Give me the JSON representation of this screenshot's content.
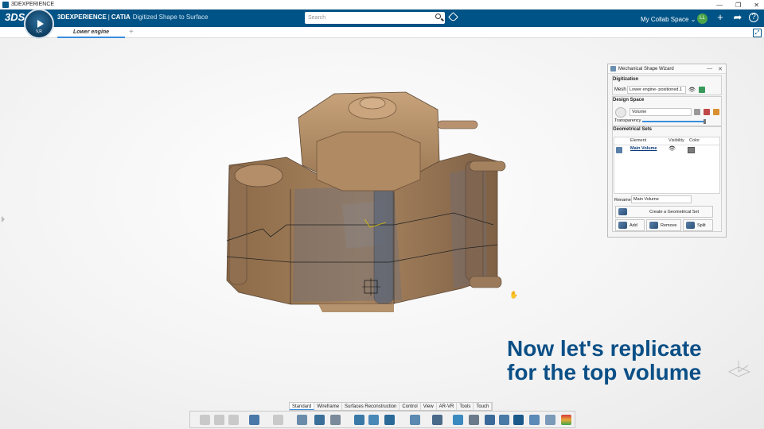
{
  "os": {
    "title": "3DEXPERIENCE",
    "controls": [
      "—",
      "❐",
      "✕"
    ]
  },
  "app": {
    "logo_text": "3DS",
    "brand_strong": "3DEXPERIENCE",
    "brand_app": "CATIA",
    "brand_module": "Digitized Shape to Surface",
    "search_placeholder": "Search",
    "collab_space": "My Collab Space",
    "avatar_initials": "LL",
    "compass_label": "V,R"
  },
  "tabs": [
    {
      "label": "Lower engine"
    }
  ],
  "wizard": {
    "title": "Mechanical Shape Wizard",
    "digitization": {
      "header": "Digitization",
      "mesh_label": "Mesh",
      "mesh_value": "Lower engine- positioned.1"
    },
    "design_space": {
      "header": "Design Space",
      "value": "Volume",
      "transparency_label": "Transparency",
      "transparency_value": 0.95
    },
    "geometrical_sets": {
      "header": "Geometrical Sets",
      "columns": [
        "Element",
        "Visibility",
        "Color"
      ],
      "rows": [
        {
          "element": "Main Volume",
          "visible": true,
          "color": "#7a7a7a"
        }
      ]
    },
    "rename_label": "Rename",
    "rename_value": "Main Volume",
    "create_button": "Create a Geometrical Set",
    "add_button": "Add",
    "remove_button": "Remove",
    "split_button": "Split"
  },
  "caption": {
    "line1": "Now let's replicate",
    "line2": "for the top volume"
  },
  "bottom_tabs": [
    "Standard",
    "Wireframe",
    "Surfaces Reconstruction",
    "Control",
    "View",
    "AR-VR",
    "Tools",
    "Touch"
  ],
  "colors": {
    "accent": "#005386",
    "caption": "#0b4f86",
    "model": "#9e7a55"
  }
}
